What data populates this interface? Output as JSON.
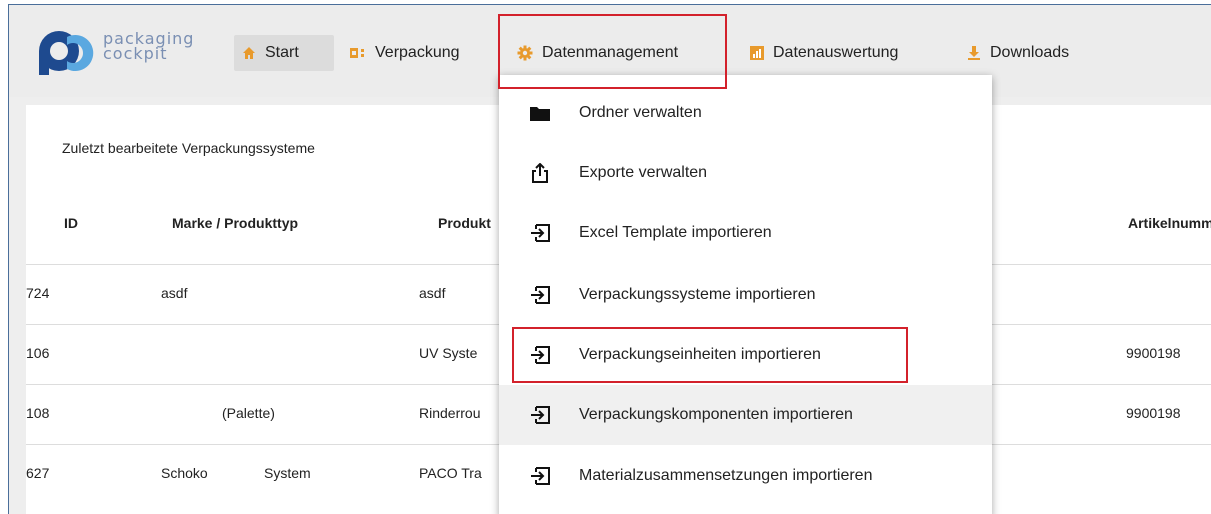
{
  "brand": {
    "line1": "packaging",
    "line2": "cockpit",
    "color_dark": "#1e4a8f",
    "color_light": "#5aa8e0"
  },
  "nav": {
    "items": [
      {
        "label": "Start",
        "icon": "home-icon"
      },
      {
        "label": "Verpackung",
        "icon": "grid-icon"
      },
      {
        "label": "Datenmanagement",
        "icon": "gear-icon"
      },
      {
        "label": "Datenauswertung",
        "icon": "chart-icon"
      },
      {
        "label": "Downloads",
        "icon": "download-icon"
      }
    ],
    "active_color": "#dcdcdc"
  },
  "recent": {
    "title": "Zuletzt bearbeitete Verpackungssysteme",
    "headers": [
      "ID",
      "Marke / Produkttyp",
      "Produkt",
      "Artikelnumm"
    ],
    "rows": [
      {
        "id": "724",
        "marke": "asdf",
        "produkt": "asdf",
        "artikel": ""
      },
      {
        "id": "106",
        "marke": "",
        "produkt": "UV Syste",
        "artikel": "9900198"
      },
      {
        "id": "108",
        "marke": "(Palette)",
        "produkt": "Rinderrou",
        "artikel": "9900198"
      },
      {
        "id": "627",
        "marke_a": "Schoko",
        "marke_b": "System",
        "produkt": "PACO Tra",
        "artikel": ""
      }
    ]
  },
  "menu": {
    "items": [
      {
        "label": "Ordner verwalten",
        "icon": "folder-icon"
      },
      {
        "label": "Exporte verwalten",
        "icon": "export-icon"
      },
      {
        "label": "Excel Template importieren",
        "icon": "import-icon"
      },
      {
        "label": "Verpackungssysteme importieren",
        "icon": "import-icon"
      },
      {
        "label": "Verpackungseinheiten importieren",
        "icon": "import-icon"
      },
      {
        "label": "Verpackungskomponenten importieren",
        "icon": "import-icon"
      },
      {
        "label": "Materialzusammensetzungen importieren",
        "icon": "import-icon"
      }
    ]
  },
  "highlight_color": "#d3212b"
}
